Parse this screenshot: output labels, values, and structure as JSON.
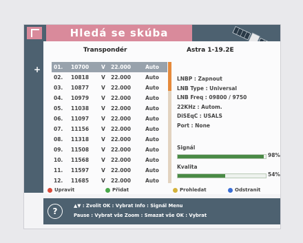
{
  "title": "Hledá se skúba",
  "list_header": "Transpondér",
  "satellite_header": "Astra 1-19.2E",
  "selection_marker": "+",
  "transponders": [
    {
      "num": "01.",
      "freq": "10700",
      "pol": "V",
      "sym": "22.000",
      "fec": "Auto"
    },
    {
      "num": "02.",
      "freq": "10818",
      "pol": "V",
      "sym": "22.000",
      "fec": "Auto"
    },
    {
      "num": "03.",
      "freq": "10877",
      "pol": "V",
      "sym": "22.000",
      "fec": "Auto"
    },
    {
      "num": "04.",
      "freq": "10979",
      "pol": "V",
      "sym": "22.000",
      "fec": "Auto"
    },
    {
      "num": "05.",
      "freq": "11038",
      "pol": "V",
      "sym": "22.000",
      "fec": "Auto"
    },
    {
      "num": "06.",
      "freq": "11097",
      "pol": "V",
      "sym": "22.000",
      "fec": "Auto"
    },
    {
      "num": "07.",
      "freq": "11156",
      "pol": "V",
      "sym": "22.000",
      "fec": "Auto"
    },
    {
      "num": "08.",
      "freq": "11318",
      "pol": "V",
      "sym": "22.000",
      "fec": "Auto"
    },
    {
      "num": "09.",
      "freq": "11508",
      "pol": "V",
      "sym": "22.000",
      "fec": "Auto"
    },
    {
      "num": "10.",
      "freq": "11568",
      "pol": "V",
      "sym": "22.000",
      "fec": "Auto"
    },
    {
      "num": "11.",
      "freq": "11597",
      "pol": "V",
      "sym": "22.000",
      "fec": "Auto"
    },
    {
      "num": "12.",
      "freq": "11685",
      "pol": "V",
      "sym": "22.000",
      "fec": "Auto"
    }
  ],
  "info": {
    "lnbp": "LNBP : Zapnout",
    "lnb_type": "LNB Type : Universal",
    "lnb_freq": "LNB Freq : 09800 / 9750",
    "khz22": "22KHz : Autom.",
    "diseqc": "DiSEqC : USALS",
    "port": "Port : None"
  },
  "signal": {
    "label": "Signál",
    "value": "98%",
    "level": 0.98
  },
  "quality": {
    "label": "Kvalita",
    "value": "54%",
    "level": 0.54
  },
  "legend": {
    "red": {
      "label": "Upravit",
      "color": "#d94a3a"
    },
    "green": {
      "label": "Přidat",
      "color": "#4aa84a"
    },
    "yellow": {
      "label": "Prohledat",
      "color": "#d4b23a"
    },
    "blue": {
      "label": "Odstranit",
      "color": "#3a6ed4"
    }
  },
  "help_icon": "?",
  "help": {
    "line1": "▲▼ : Zvolit  OK : Vybrat   Info : Signál Menu",
    "line2": "Pause : Vybrat vše   Zoom : Smazat vše   OK : Vybrat"
  },
  "colors": {
    "header": "#4d6170",
    "title_band": "#d98a9b",
    "scroll": "#e58a3c",
    "bar": "#4a8a46"
  }
}
